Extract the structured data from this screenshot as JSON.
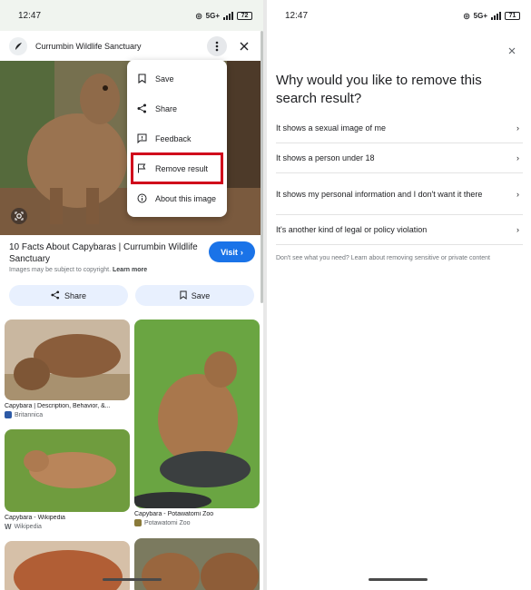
{
  "left": {
    "status_time": "12:47",
    "network": "5G+",
    "battery": "72",
    "header_title": "Currumbin Wildlife Sanctuary",
    "menu": [
      "Save",
      "Share",
      "Feedback",
      "Remove result",
      "About this image"
    ],
    "result_title": "10 Facts About Capybaras | Currumbin Wildlife Sanctuary",
    "visit_label": "Visit",
    "copyright_text": "Images may be subject to copyright.",
    "learn_more": "Learn more",
    "share_label": "Share",
    "save_label": "Save",
    "grid": [
      {
        "caption": "Capybara | Description, Behavior, &...",
        "source": "Britannica"
      },
      {
        "caption": "Capybara - Wikipedia",
        "source": "Wikipedia"
      },
      {
        "caption": "Capybara - Potawatomi Zoo",
        "source": "Potawatomi Zoo"
      }
    ]
  },
  "right": {
    "status_time": "12:47",
    "network": "5G+",
    "battery": "71",
    "question": "Why would you like to remove this search result?",
    "options": [
      "It shows a sexual image of me",
      "It shows a person under 18",
      "It shows my personal information and I don't want it there",
      "It's another kind of legal or policy violation"
    ],
    "footer": "Don't see what you need? Learn about removing sensitive or private content"
  },
  "colors": {
    "accent": "#1a73e8",
    "highlight": "#d0021b",
    "pill": "#e8f0fe"
  },
  "icons": [
    "search-logo-icon",
    "more-vert-icon",
    "close-icon",
    "bookmark-icon",
    "share-icon",
    "feedback-icon",
    "flag-icon",
    "info-icon",
    "lens-icon",
    "chevron-right-icon"
  ]
}
